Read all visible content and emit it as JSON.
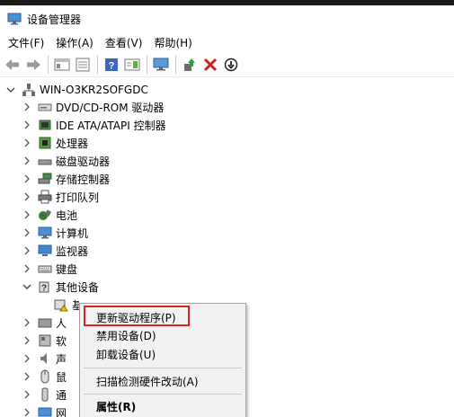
{
  "window": {
    "title": "设备管理器"
  },
  "menubar": {
    "items": [
      {
        "label": "文件(F)"
      },
      {
        "label": "操作(A)"
      },
      {
        "label": "查看(V)"
      },
      {
        "label": "帮助(H)"
      }
    ]
  },
  "toolbar": {
    "buttons": [
      "back-icon",
      "forward-icon",
      "properties-pane-icon",
      "list-view-icon",
      "help-icon",
      "details-icon",
      "monitor-scan-icon",
      "update-driver-icon",
      "uninstall-icon",
      "disable-icon"
    ]
  },
  "tree": {
    "root": {
      "label": "WIN-O3KR2SOFGDC"
    },
    "nodes": [
      {
        "label": "DVD/CD-ROM 驱动器",
        "icon": "dvd-drive-icon"
      },
      {
        "label": "IDE ATA/ATAPI 控制器",
        "icon": "ide-controller-icon"
      },
      {
        "label": "处理器",
        "icon": "processor-icon"
      },
      {
        "label": "磁盘驱动器",
        "icon": "disk-drive-icon"
      },
      {
        "label": "存储控制器",
        "icon": "storage-controller-icon"
      },
      {
        "label": "打印队列",
        "icon": "printer-icon"
      },
      {
        "label": "电池",
        "icon": "battery-icon"
      },
      {
        "label": "计算机",
        "icon": "computer-icon"
      },
      {
        "label": "监视器",
        "icon": "monitor-icon"
      },
      {
        "label": "键盘",
        "icon": "keyboard-icon"
      },
      {
        "label": "其他设备",
        "icon": "other-devices-icon"
      }
    ],
    "child_partial": {
      "label": "基本系统设备"
    },
    "below_partial": [
      {
        "label": "人",
        "icon": "hid-icon"
      },
      {
        "label": "软",
        "icon": "software-device-icon"
      },
      {
        "label": "声",
        "icon": "audio-icon"
      },
      {
        "label": "鼠",
        "icon": "mouse-icon"
      },
      {
        "label": "通",
        "icon": "usb-icon"
      },
      {
        "label": "网",
        "icon": "network-icon"
      }
    ]
  },
  "context_menu": {
    "items": [
      {
        "label": "更新驱动程序(P)"
      },
      {
        "label": "禁用设备(D)"
      },
      {
        "label": "卸载设备(U)"
      },
      {
        "label": "扫描检测硬件改动(A)"
      },
      {
        "label": "属性(R)"
      }
    ]
  },
  "colors": {
    "highlight_border": "#d6242a",
    "menu_bg": "#f2f2f2"
  }
}
